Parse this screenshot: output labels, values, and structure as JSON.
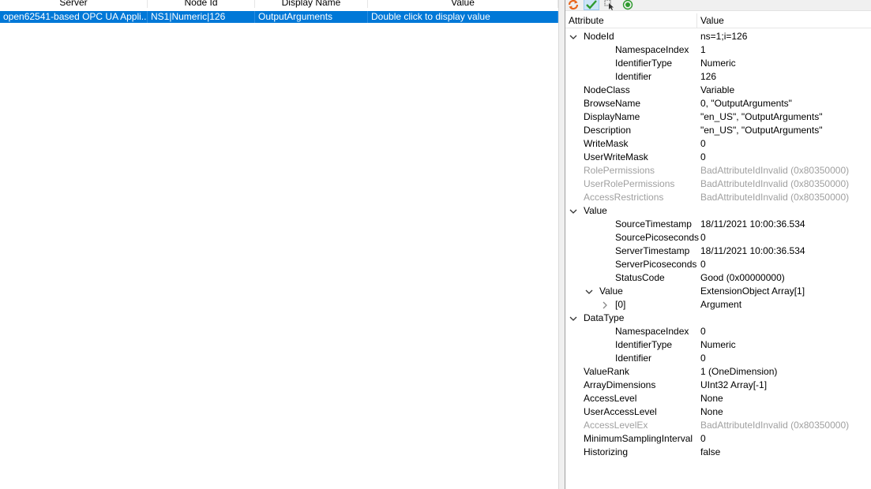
{
  "grid": {
    "columns": [
      "Server",
      "Node Id",
      "Display Name",
      "Value"
    ],
    "rows": [
      {
        "server": "open62541-based OPC UA Appli...",
        "node_id": "NS1|Numeric|126",
        "display_name": "OutputArguments",
        "value": "Double click to display value"
      }
    ]
  },
  "toolbar": {
    "icons": [
      "refresh-icon",
      "check-icon",
      "select-icon",
      "record-icon"
    ]
  },
  "attributes": {
    "header": {
      "attribute": "Attribute",
      "value": "Value"
    },
    "rows": [
      {
        "name": "NodeId",
        "value": "ns=1;i=126",
        "expand": "expanded"
      },
      {
        "name": "NamespaceIndex",
        "value": "1"
      },
      {
        "name": "IdentifierType",
        "value": "Numeric"
      },
      {
        "name": "Identifier",
        "value": "126"
      },
      {
        "name": "NodeClass",
        "value": "Variable"
      },
      {
        "name": "BrowseName",
        "value": "0, \"OutputArguments\""
      },
      {
        "name": "DisplayName",
        "value": "\"en_US\", \"OutputArguments\""
      },
      {
        "name": "Description",
        "value": "\"en_US\", \"OutputArguments\""
      },
      {
        "name": "WriteMask",
        "value": "0"
      },
      {
        "name": "UserWriteMask",
        "value": "0"
      },
      {
        "name": "RolePermissions",
        "value": "BadAttributeIdInvalid (0x80350000)"
      },
      {
        "name": "UserRolePermissions",
        "value": "BadAttributeIdInvalid (0x80350000)"
      },
      {
        "name": "AccessRestrictions",
        "value": "BadAttributeIdInvalid (0x80350000)"
      },
      {
        "name": "Value",
        "value": "",
        "expand": "expanded"
      },
      {
        "name": "SourceTimestamp",
        "value": "18/11/2021 10:00:36.534"
      },
      {
        "name": "SourcePicoseconds",
        "value": "0"
      },
      {
        "name": "ServerTimestamp",
        "value": "18/11/2021 10:00:36.534"
      },
      {
        "name": "ServerPicoseconds",
        "value": "0"
      },
      {
        "name": "StatusCode",
        "value": "Good (0x00000000)"
      },
      {
        "name": "Value",
        "value": "ExtensionObject Array[1]",
        "expand": "expanded"
      },
      {
        "name": "[0]",
        "value": "Argument",
        "expand": "collapsed"
      },
      {
        "name": "DataType",
        "value": "",
        "expand": "expanded"
      },
      {
        "name": "NamespaceIndex",
        "value": "0"
      },
      {
        "name": "IdentifierType",
        "value": "Numeric"
      },
      {
        "name": "Identifier",
        "value": "0"
      },
      {
        "name": "ValueRank",
        "value": "1 (OneDimension)"
      },
      {
        "name": "ArrayDimensions",
        "value": "UInt32 Array[-1]"
      },
      {
        "name": "AccessLevel",
        "value": "None"
      },
      {
        "name": "UserAccessLevel",
        "value": "None"
      },
      {
        "name": "AccessLevelEx",
        "value": "BadAttributeIdInvalid (0x80350000)"
      },
      {
        "name": "MinimumSamplingInterval",
        "value": "0"
      },
      {
        "name": "Historizing",
        "value": "false"
      }
    ]
  },
  "colors": {
    "selection": "#0078d7",
    "dim_text": "#a0a0a0",
    "refresh_icon": "#e8661d",
    "check_icon": "#2e9a2e",
    "record_icon": "#2e9a2e"
  }
}
